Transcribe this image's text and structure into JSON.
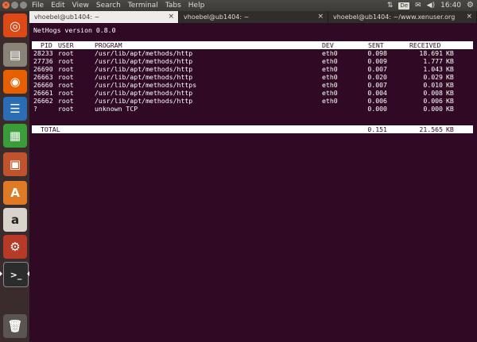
{
  "window": {
    "tab1_title": "vhoebel@ub1404: ~",
    "tab2_title": "vhoebel@ub1404: ~",
    "tab3_title": "vhoebel@ub1404: ~/www.xenuser.org"
  },
  "menu": [
    "File",
    "Edit",
    "View",
    "Search",
    "Terminal",
    "Tabs",
    "Help"
  ],
  "indicators": {
    "keyboard": "De",
    "time": "16:40"
  },
  "launcher": [
    "ubuntu-dash",
    "files",
    "firefox",
    "writer",
    "calc",
    "impress",
    "software-center",
    "amazon",
    "system-settings",
    "terminal",
    "trash"
  ],
  "nethogs": {
    "version_line": "NetHogs version 0.8.0",
    "headers": {
      "pid": "PID",
      "user": "USER",
      "program": "PROGRAM",
      "dev": "DEV",
      "sent": "SENT",
      "received": "RECEIVED"
    },
    "rows": [
      {
        "pid": "28233",
        "user": "root",
        "program": "/usr/lib/apt/methods/http",
        "dev": "eth0",
        "sent": "0.098",
        "received": "18.691",
        "unit": "KB"
      },
      {
        "pid": "27736",
        "user": "root",
        "program": "/usr/lib/apt/methods/http",
        "dev": "eth0",
        "sent": "0.009",
        "received": "1.777",
        "unit": "KB"
      },
      {
        "pid": "26690",
        "user": "root",
        "program": "/usr/lib/apt/methods/http",
        "dev": "eth0",
        "sent": "0.007",
        "received": "1.043",
        "unit": "KB"
      },
      {
        "pid": "26663",
        "user": "root",
        "program": "/usr/lib/apt/methods/http",
        "dev": "eth0",
        "sent": "0.020",
        "received": "0.029",
        "unit": "KB"
      },
      {
        "pid": "26660",
        "user": "root",
        "program": "/usr/lib/apt/methods/https",
        "dev": "eth0",
        "sent": "0.007",
        "received": "0.010",
        "unit": "KB"
      },
      {
        "pid": "26661",
        "user": "root",
        "program": "/usr/lib/apt/methods/http",
        "dev": "eth0",
        "sent": "0.004",
        "received": "0.008",
        "unit": "KB"
      },
      {
        "pid": "26662",
        "user": "root",
        "program": "/usr/lib/apt/methods/http",
        "dev": "eth0",
        "sent": "0.006",
        "received": "0.006",
        "unit": "KB"
      },
      {
        "pid": "?",
        "user": "root",
        "program": "unknown TCP",
        "dev": "",
        "sent": "0.000",
        "received": "0.000",
        "unit": "KB"
      }
    ],
    "total": {
      "label": "TOTAL",
      "sent": "0.151",
      "received": "21.565",
      "unit": "KB"
    }
  }
}
